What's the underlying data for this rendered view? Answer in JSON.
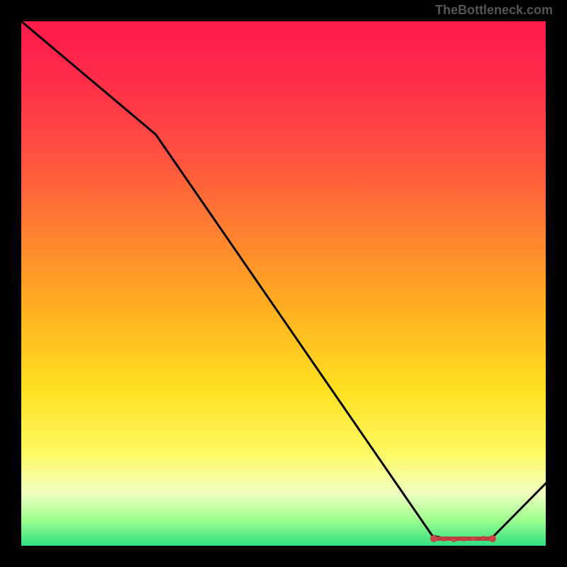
{
  "watermark": "TheBottleneck.com",
  "chart_data": {
    "type": "line",
    "title": "",
    "xlabel": "",
    "ylabel": "",
    "xlim": [
      0,
      100
    ],
    "ylim": [
      0,
      100
    ],
    "gradient_colors": {
      "top": "#ff1a4a",
      "mid_upper": "#ff8030",
      "mid": "#ffe020",
      "mid_lower": "#fff860",
      "bottom": "#30e080"
    },
    "series": [
      {
        "name": "curve",
        "color": "#000000",
        "x": [
          0,
          25,
          78,
          82,
          90,
          100
        ],
        "y": [
          100,
          78,
          2,
          1,
          2,
          12
        ]
      }
    ],
    "marker_band": {
      "name": "optimal-range",
      "color": "#d05050",
      "x_start": 78,
      "x_end": 90,
      "y": 1.5
    }
  }
}
